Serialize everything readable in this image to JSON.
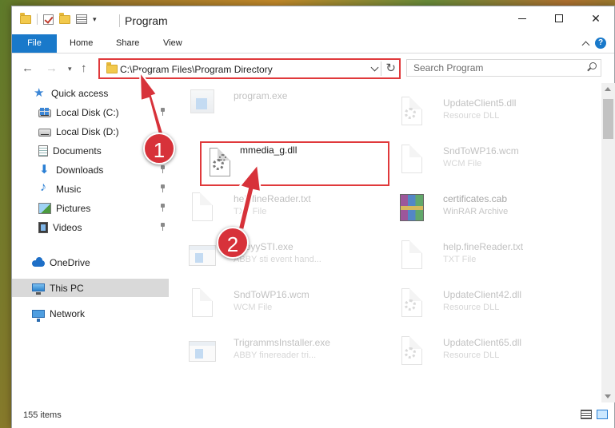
{
  "window": {
    "title": "Program",
    "ribbon_tabs": [
      "File",
      "Home",
      "Share",
      "View"
    ],
    "help_label": "?"
  },
  "address": {
    "path": "C:\\Program Files\\Program Directory",
    "search_placeholder": "Search Program"
  },
  "sidebar": {
    "items": [
      {
        "label": "Quick access",
        "icon": "star-icon"
      },
      {
        "label": "Local Disk (C:)",
        "icon": "drive-icon"
      },
      {
        "label": "Local Disk (D:)",
        "icon": "drive-icon"
      },
      {
        "label": "Documents",
        "icon": "documents-icon"
      },
      {
        "label": "Downloads",
        "icon": "download-icon"
      },
      {
        "label": "Music",
        "icon": "music-icon"
      },
      {
        "label": "Pictures",
        "icon": "pictures-icon"
      },
      {
        "label": "Videos",
        "icon": "videos-icon"
      },
      {
        "label": "OneDrive",
        "icon": "cloud-icon"
      },
      {
        "label": "This PC",
        "icon": "computer-icon"
      },
      {
        "label": "Network",
        "icon": "network-icon"
      }
    ]
  },
  "files": {
    "left": [
      {
        "name": "program.exe",
        "desc": ""
      },
      {
        "name": "mmedia_g.dll",
        "desc": ""
      },
      {
        "name": "helpfineReader.txt",
        "desc": "TXT File"
      },
      {
        "name": "AbbyySTI.exe",
        "desc": "ABBY sti event hand..."
      },
      {
        "name": "SndToWP16.wcm",
        "desc": "WCM File"
      },
      {
        "name": "TrigrammsInstaller.exe",
        "desc": "ABBY finereader tri..."
      }
    ],
    "right": [
      {
        "name": "UpdateClient5.dll",
        "desc": "Resource DLL"
      },
      {
        "name": "SndToWP16.wcm",
        "desc": "WCM File"
      },
      {
        "name": "certificates.cab",
        "desc": "WinRAR Archive"
      },
      {
        "name": "help.fineReader.txt",
        "desc": "TXT File"
      },
      {
        "name": "UpdateClient42.dll",
        "desc": "Resource DLL"
      },
      {
        "name": "UpdateClient65.dll",
        "desc": "Resource DLL"
      }
    ]
  },
  "status": {
    "item_count": "155 items"
  },
  "annotations": {
    "step1": "1",
    "step2": "2",
    "highlight_color": "#e0393b"
  }
}
